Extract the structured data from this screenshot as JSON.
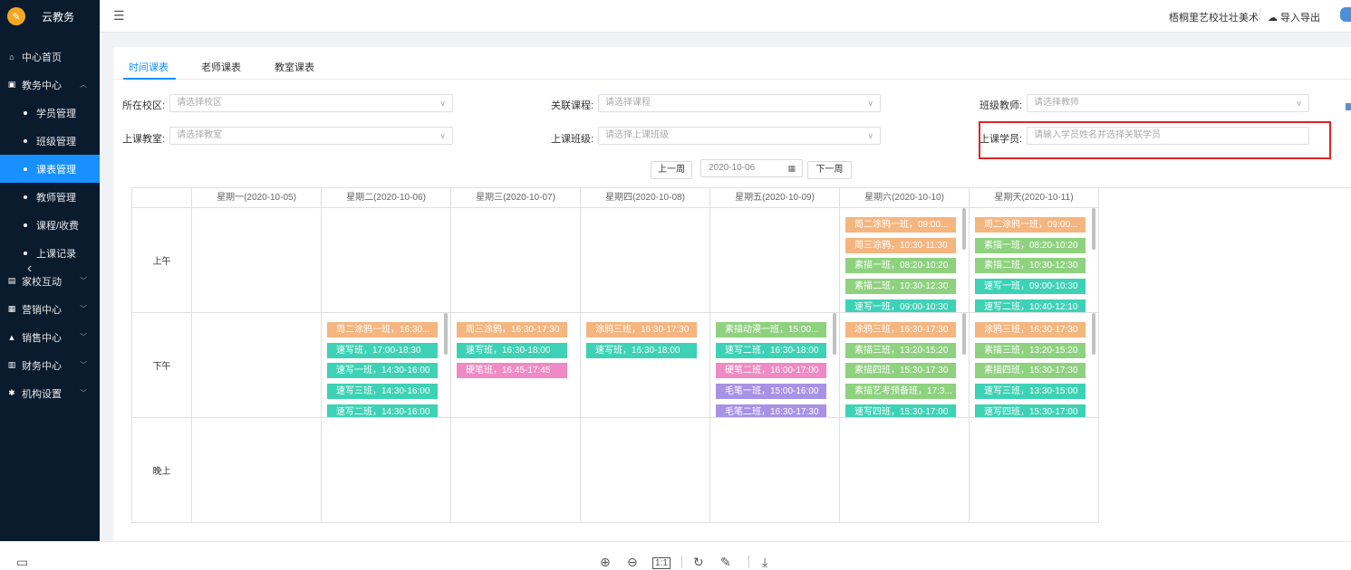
{
  "app": {
    "title": "云教务",
    "logo_glyph": "✎"
  },
  "sidebar": {
    "items": [
      {
        "label": "中心首页",
        "icon": "home-icon"
      },
      {
        "label": "教务中心",
        "icon": "book-icon",
        "expanded": true
      },
      {
        "label": "家校互动",
        "icon": "chat-icon"
      },
      {
        "label": "营销中心",
        "icon": "briefcase-icon"
      },
      {
        "label": "销售中心",
        "icon": "chart-icon"
      },
      {
        "label": "财务中心",
        "icon": "wallet-icon"
      },
      {
        "label": "机构设置",
        "icon": "gear-icon"
      }
    ],
    "sub_items": [
      {
        "label": "学员管理"
      },
      {
        "label": "班级管理"
      },
      {
        "label": "课表管理",
        "active": true
      },
      {
        "label": "教师管理"
      },
      {
        "label": "课程/收费"
      },
      {
        "label": "上课记录"
      }
    ]
  },
  "header": {
    "school": "梧桐里艺校壮壮美术",
    "import_export": "导入导出"
  },
  "tabs": [
    "时间课表",
    "老师课表",
    "教室课表"
  ],
  "filters": {
    "campus": {
      "label": "所在校区:",
      "placeholder": "请选择校区"
    },
    "course": {
      "label": "关联课程:",
      "placeholder": "请选择课程"
    },
    "teacher": {
      "label": "班级教师:",
      "placeholder": "请选择教师"
    },
    "room": {
      "label": "上课教室:",
      "placeholder": "请选择教室"
    },
    "class": {
      "label": "上课班级:",
      "placeholder": "请选择上课班级"
    },
    "student": {
      "label": "上课学员:",
      "placeholder": "请输入学员姓名并选择关联学员"
    }
  },
  "week_nav": {
    "prev": "上一周",
    "date": "2020-10-06",
    "next": "下一周"
  },
  "timetable": {
    "days": [
      "星期一(2020-10-05)",
      "星期二(2020-10-06)",
      "星期三(2020-10-07)",
      "星期四(2020-10-08)",
      "星期五(2020-10-09)",
      "星期六(2020-10-10)",
      "星期天(2020-10-11)"
    ],
    "periods": [
      "上午",
      "下午",
      "晚上"
    ],
    "colors": {
      "orange": "#f5b57f",
      "teal": "#3dd2b5",
      "green": "#8ed17f",
      "pink": "#ef8ac4",
      "purple": "#a892e6"
    },
    "morning": {
      "sat": [
        {
          "text": "周二涂鸦一班，09:00...",
          "color": "orange"
        },
        {
          "text": "周三涂鸦，10:30-11:30",
          "color": "orange"
        },
        {
          "text": "素描一班，08:20-10:20",
          "color": "green"
        },
        {
          "text": "素描二班，10:30-12:30",
          "color": "green"
        },
        {
          "text": "速写一班，09:00-10:30",
          "color": "teal"
        }
      ],
      "sun": [
        {
          "text": "周二涂鸦一班，09:00...",
          "color": "orange"
        },
        {
          "text": "素描一班，08:20-10:20",
          "color": "green"
        },
        {
          "text": "素描二班，10:30-12:30",
          "color": "green"
        },
        {
          "text": "速写一班，09:00-10:30",
          "color": "teal"
        },
        {
          "text": "速写二班，10:40-12:10",
          "color": "teal"
        }
      ]
    },
    "afternoon": {
      "tue": [
        {
          "text": "周二涂鸦一班，16:30...",
          "color": "orange"
        },
        {
          "text": "速写班，17:00-18:30",
          "color": "teal"
        },
        {
          "text": "速写一班，14:30-16:00",
          "color": "teal"
        },
        {
          "text": "速写三班，14:30-16:00",
          "color": "teal"
        },
        {
          "text": "速写二班，14:30-16:00",
          "color": "teal"
        }
      ],
      "wed": [
        {
          "text": "周三涂鸦，16:30-17:30",
          "color": "orange"
        },
        {
          "text": "速写班，16:30-18:00",
          "color": "teal"
        },
        {
          "text": "硬笔班，16:45-17:45",
          "color": "pink"
        }
      ],
      "thu": [
        {
          "text": "涂鸦三班，16:30-17:30",
          "color": "orange"
        },
        {
          "text": "速写班，16:30-18:00",
          "color": "teal"
        }
      ],
      "fri": [
        {
          "text": "素描动漫一班，15:00...",
          "color": "green"
        },
        {
          "text": "速写二班，16:30-18:00",
          "color": "teal"
        },
        {
          "text": "硬笔二班，16:00-17:00",
          "color": "pink"
        },
        {
          "text": "毛笔一班，15:00-16:00",
          "color": "purple"
        },
        {
          "text": "毛笔二班，16:30-17:30",
          "color": "purple"
        }
      ],
      "sat": [
        {
          "text": "涂鸦三班，16:30-17:30",
          "color": "orange"
        },
        {
          "text": "素描三班，13:20-15:20",
          "color": "green"
        },
        {
          "text": "素描四班，15:30-17:30",
          "color": "green"
        },
        {
          "text": "素描艺考预备班，17:3...",
          "color": "green"
        },
        {
          "text": "速写四班，15:30-17:00",
          "color": "teal"
        }
      ],
      "sun": [
        {
          "text": "涂鸦三班，16:30-17:30",
          "color": "orange"
        },
        {
          "text": "素描三班，13:20-15:20",
          "color": "green"
        },
        {
          "text": "素描四班，15:30-17:30",
          "color": "green"
        },
        {
          "text": "速写三班，13:30-15:00",
          "color": "teal"
        },
        {
          "text": "速写四班，15:30-17:00",
          "color": "teal"
        }
      ]
    }
  },
  "bottom_toolbar": {
    "zoom_ratio": "1:1"
  }
}
